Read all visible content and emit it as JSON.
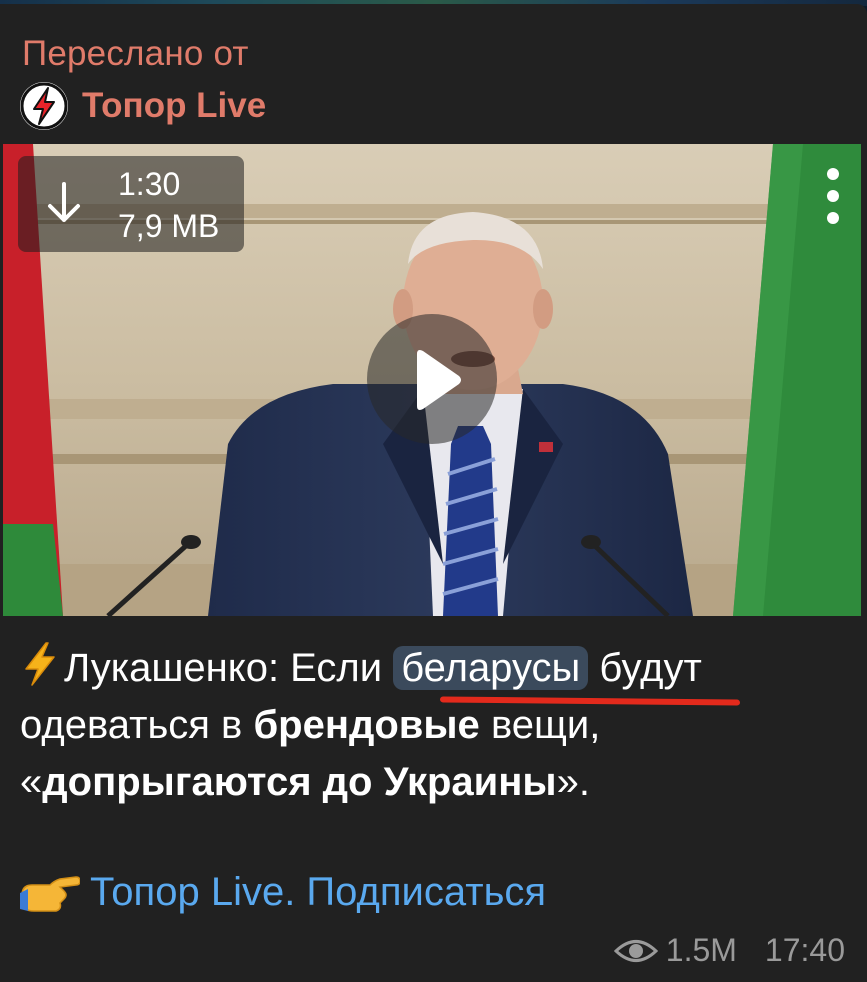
{
  "forward": {
    "label": "Переслано от",
    "channel_name": "Топор Live"
  },
  "video": {
    "duration": "1:30",
    "size": "7,9 MB",
    "icons": {
      "download": "download-arrow-icon",
      "menu": "more-vertical-icon",
      "play": "play-icon"
    }
  },
  "caption": {
    "name": "Лукашенко: Если",
    "highlight": "беларусы",
    "part2": "будут",
    "part3": "одеваться в",
    "bold1": "брендовые",
    "part4": "вещи,",
    "quote_open": "«",
    "bold2": "допрыгаются до Украины",
    "quote_close": "».",
    "underline_color": "#e32a1c"
  },
  "link": {
    "text": "Топор Live. Подписаться",
    "color": "#5aa9ef"
  },
  "meta": {
    "views": "1.5M",
    "time": "17:40"
  },
  "colors": {
    "forward_accent": "#e07b6a",
    "bubble_bg": "#212121"
  }
}
